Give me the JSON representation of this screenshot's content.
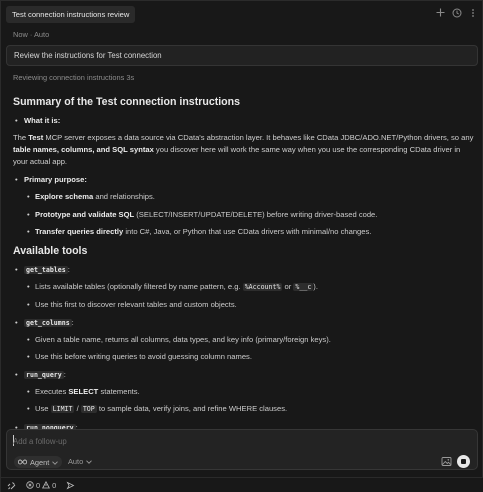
{
  "header": {
    "tab_title": "Test connection instructions review",
    "icons": [
      "plus-icon",
      "history-icon",
      "more-icon"
    ]
  },
  "meta": {
    "time": "Now",
    "separator": "·",
    "mode": "Auto"
  },
  "user_prompt": "Review the instructions for Test connection",
  "status": {
    "text": "Reviewing connection instructions",
    "elapsed": "3s"
  },
  "summary": {
    "heading": "Summary of the Test connection instructions",
    "what_label": "What it is:",
    "what_p": {
      "t1": "The ",
      "b1": "Test",
      "t2": " MCP server exposes a data source via CData's abstraction layer. It behaves like CData JDBC/ADO.NET/Python drivers, so any ",
      "b2": "table names, columns, and SQL syntax",
      "t3": " you discover here will work the same way when you use the corresponding CData driver in your actual app."
    },
    "purpose_label": "Primary purpose:",
    "purposes": [
      {
        "bold": "Explore schema",
        "rest": " and relationships."
      },
      {
        "bold": "Prototype and validate SQL",
        "rest": " (SELECT/INSERT/UPDATE/DELETE) before writing driver-based code."
      },
      {
        "bold": "Transfer queries directly",
        "rest": " into C#, Java, or Python that use CData drivers with minimal/no changes."
      }
    ]
  },
  "tools": {
    "heading": "Available tools",
    "get_tables": {
      "name": "get_tables",
      "colon": ":",
      "b1_pre": "Lists available tables (optionally filtered by name pattern, e.g. ",
      "code1": "%Account%",
      "b1_mid": " or ",
      "code2": "%__c",
      "b1_post": ").",
      "b2": "Use this first to discover relevant tables and custom objects."
    },
    "get_columns": {
      "name": "get_columns",
      "colon": ":",
      "b1": "Given a table name, returns all columns, data types, and key info (primary/foreign keys).",
      "b2": "Use this before writing queries to avoid guessing column names."
    },
    "run_query": {
      "name": "run_query",
      "colon": ":",
      "b1_pre": "Executes ",
      "b1_bold": "SELECT",
      "b1_post": " statements.",
      "b2_pre": "Use ",
      "code1": "LIMIT",
      "b2_sep": " / ",
      "code2": "TOP",
      "b2_post": " to sample data, verify joins, and refine WHERE clauses."
    },
    "run_nonquery": {
      "name": "run_nonquery",
      "colon": ":"
    }
  },
  "composer": {
    "placeholder": "Add a follow-up",
    "agent_label": "Agent",
    "model_label": "Auto"
  },
  "statusbar": {
    "errors": "0",
    "warnings": "0"
  }
}
